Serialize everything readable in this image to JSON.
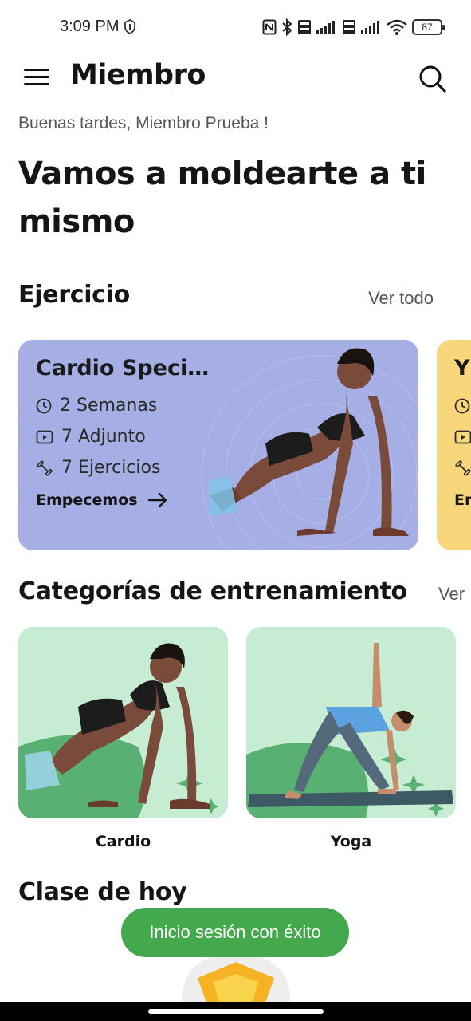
{
  "status_bar": {
    "time": "3:09 PM",
    "battery": "87",
    "icons": [
      "alarm-icon",
      "nfc-icon",
      "bluetooth-icon",
      "volte-icon",
      "signal-icon",
      "volte-icon",
      "signal-icon",
      "wifi-icon",
      "battery-icon"
    ]
  },
  "app_bar": {
    "title": "Miembro",
    "menu_icon": "menu-icon",
    "search_icon": "search-icon"
  },
  "greeting": "Buenas tardes, Miembro Prueba !",
  "headline": "Vamos a moldearte a ti mismo",
  "exercise_section": {
    "title": "Ejercicio",
    "see_all": "Ver todo",
    "cards": [
      {
        "title": "Cardio Speci…",
        "duration": "2 Semanas",
        "attachments": "7 Adjunto",
        "exercises": "7 Ejercicios",
        "cta": "Empecemos",
        "color": "#a6aee6"
      },
      {
        "title": "Y",
        "cta": "Em",
        "color": "#f8d77c"
      }
    ]
  },
  "categories_section": {
    "title": "Categorías de entrenamiento",
    "see_all": "Ver",
    "items": [
      {
        "label": "Cardio"
      },
      {
        "label": "Yoga"
      }
    ]
  },
  "today_section": {
    "title": "Clase de hoy"
  },
  "toast": "Inicio sesión con éxito",
  "colors": {
    "accent_green": "#43a94c",
    "tile_green": "#c6ecd3",
    "tile_dark_green": "#58b173",
    "card_purple": "#a6aee6",
    "card_yellow": "#f8d77c"
  }
}
